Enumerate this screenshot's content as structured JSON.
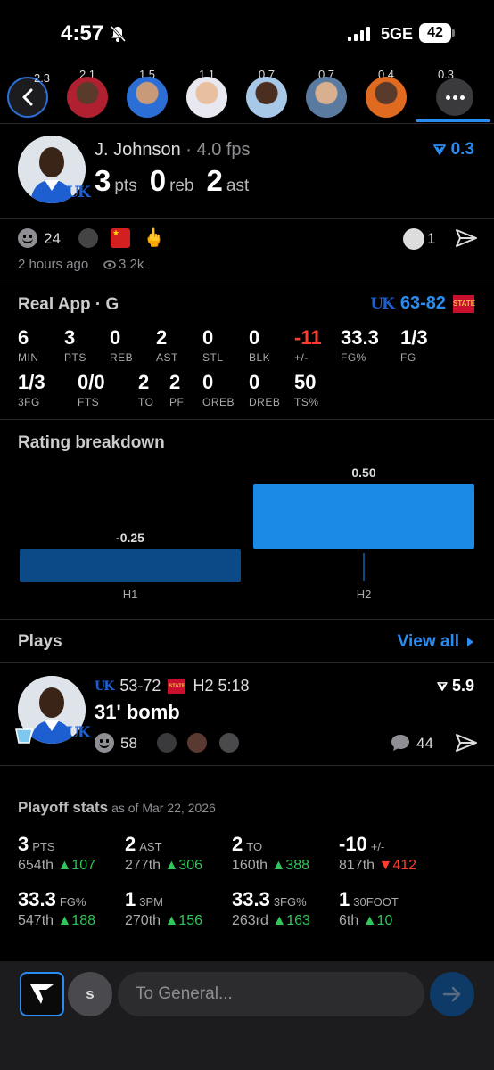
{
  "status_bar": {
    "time": "4:57",
    "network": "5GE",
    "battery": "42"
  },
  "strip": {
    "ratings": [
      "2.3",
      "2.1",
      "1.5",
      "1.1",
      "0.7",
      "0.7",
      "0.4",
      "0.3"
    ]
  },
  "player": {
    "name": "J. Johnson",
    "fps": "4.0 fps",
    "pts": "3",
    "pts_label": "pts",
    "reb": "0",
    "reb_label": "reb",
    "ast": "2",
    "ast_label": "ast",
    "rating": "0.3",
    "team_badge": "UK"
  },
  "post": {
    "reaction_count": "24",
    "tiny_count": "1",
    "time_ago": "2 hours ago",
    "views": "3.2k"
  },
  "game": {
    "app_label": "Real App · G",
    "home_score": "63",
    "away_score": "82",
    "away_badge": "STATE"
  },
  "box_stats": [
    {
      "v": "6",
      "l": "MIN"
    },
    {
      "v": "3",
      "l": "PTS"
    },
    {
      "v": "0",
      "l": "REB"
    },
    {
      "v": "2",
      "l": "AST"
    },
    {
      "v": "0",
      "l": "STL"
    },
    {
      "v": "0",
      "l": "BLK"
    },
    {
      "v": "-11",
      "l": "+/-"
    },
    {
      "v": "33.3",
      "l": "FG%"
    },
    {
      "v": "1/3",
      "l": "FG"
    },
    {
      "v": "1/3",
      "l": "3FG"
    },
    {
      "v": "0/0",
      "l": "FTS"
    },
    {
      "v": "2",
      "l": "TO"
    },
    {
      "v": "2",
      "l": "PF"
    },
    {
      "v": "0",
      "l": "OREB"
    },
    {
      "v": "0",
      "l": "DREB"
    },
    {
      "v": "50",
      "l": "TS%"
    }
  ],
  "rating_breakdown_title": "Rating breakdown",
  "chart_data": {
    "type": "bar",
    "categories": [
      "H1",
      "H2"
    ],
    "values": [
      -0.25,
      0.5
    ],
    "value_labels": [
      "-0.25",
      "0.50"
    ],
    "colors": [
      "#0b4a86",
      "#1a8ae6"
    ],
    "ylim": [
      -0.25,
      0.5
    ]
  },
  "plays": {
    "title": "Plays",
    "view_all": "View all",
    "item": {
      "score_home": "53",
      "score_away": "72",
      "clock": "H2 5:18",
      "rating": "5.9",
      "title": "31' bomb",
      "reactions": "58",
      "comments": "44"
    }
  },
  "playoff": {
    "title": "Playoff stats",
    "as_of": "as of Mar 22, 2026",
    "stats": [
      {
        "v": "3",
        "u": "PTS",
        "rank": "654th",
        "dir": "up",
        "delta": "107"
      },
      {
        "v": "2",
        "u": "AST",
        "rank": "277th",
        "dir": "up",
        "delta": "306"
      },
      {
        "v": "2",
        "u": "TO",
        "rank": "160th",
        "dir": "up",
        "delta": "388"
      },
      {
        "v": "-10",
        "u": "+/-",
        "rank": "817th",
        "dir": "down",
        "delta": "412"
      },
      {
        "v": "33.3",
        "u": "FG%",
        "rank": "547th",
        "dir": "up",
        "delta": "188"
      },
      {
        "v": "1",
        "u": "3PM",
        "rank": "270th",
        "dir": "up",
        "delta": "156"
      },
      {
        "v": "33.3",
        "u": "3FG%",
        "rank": "263rd",
        "dir": "up",
        "delta": "163"
      },
      {
        "v": "1",
        "u": "30FOOT",
        "rank": "6th",
        "dir": "up",
        "delta": "10"
      }
    ]
  },
  "composer": {
    "avatar_letter": "s",
    "placeholder": "To General..."
  }
}
